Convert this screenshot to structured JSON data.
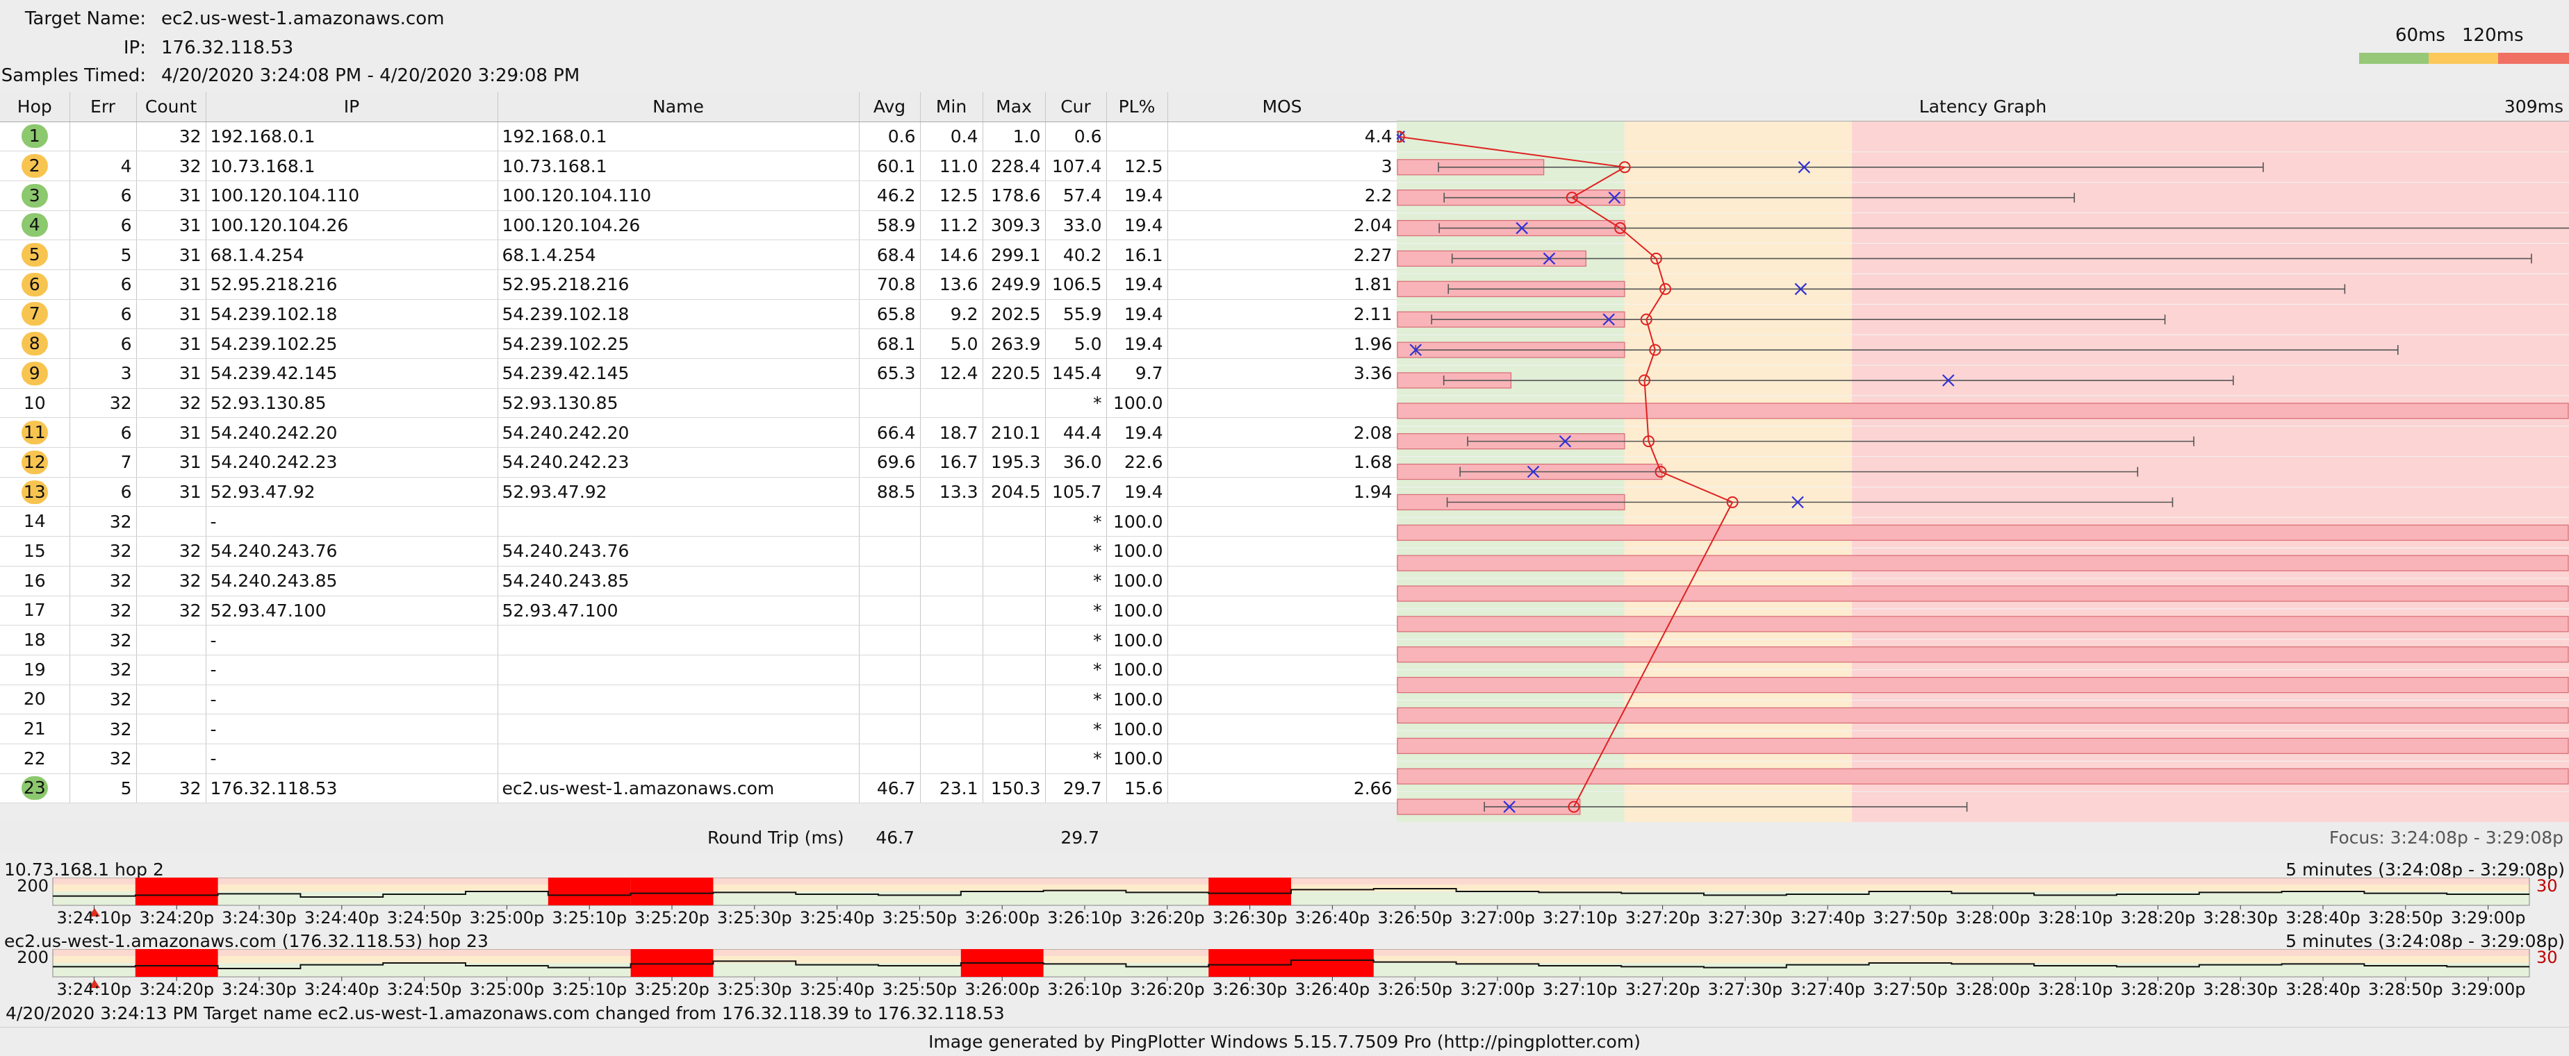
{
  "header": {
    "target_label": "Target Name:",
    "target_value": "ec2.us-west-1.amazonaws.com",
    "ip_label": "IP:",
    "ip_value": "176.32.118.53",
    "samples_label": "Samples Timed:",
    "samples_value": "4/20/2020 3:24:08 PM - 4/20/2020 3:29:08 PM"
  },
  "scale": {
    "label1": "60ms",
    "label2": "120ms",
    "color_good": "#96c878",
    "color_mid": "#fcc85a",
    "color_bad": "#f07064"
  },
  "columns": [
    "Hop",
    "Err",
    "Count",
    "IP",
    "Name",
    "Avg",
    "Min",
    "Max",
    "Cur",
    "PL%",
    "MOS"
  ],
  "graph_header": {
    "title": "Latency Graph",
    "max_label": "309ms"
  },
  "chart_data": {
    "type": "table",
    "title": "",
    "x_max_ms": 309,
    "zone_thresholds_ms": [
      60,
      120
    ],
    "rows": [
      {
        "hop": "1",
        "status": "green",
        "err": "",
        "count": "32",
        "ip": "192.168.0.1",
        "name": "192.168.0.1",
        "avg": "0.6",
        "min": "0.4",
        "max": "1.0",
        "cur": "0.6",
        "pl": "",
        "mos": "4.4"
      },
      {
        "hop": "2",
        "status": "orange",
        "err": "4",
        "count": "32",
        "ip": "10.73.168.1",
        "name": "10.73.168.1",
        "avg": "60.1",
        "min": "11.0",
        "max": "228.4",
        "cur": "107.4",
        "pl": "12.5",
        "mos": "3"
      },
      {
        "hop": "3",
        "status": "green",
        "err": "6",
        "count": "31",
        "ip": "100.120.104.110",
        "name": "100.120.104.110",
        "avg": "46.2",
        "min": "12.5",
        "max": "178.6",
        "cur": "57.4",
        "pl": "19.4",
        "mos": "2.2"
      },
      {
        "hop": "4",
        "status": "green",
        "err": "6",
        "count": "31",
        "ip": "100.120.104.26",
        "name": "100.120.104.26",
        "avg": "58.9",
        "min": "11.2",
        "max": "309.3",
        "cur": "33.0",
        "pl": "19.4",
        "mos": "2.04"
      },
      {
        "hop": "5",
        "status": "orange",
        "err": "5",
        "count": "31",
        "ip": "68.1.4.254",
        "name": "68.1.4.254",
        "avg": "68.4",
        "min": "14.6",
        "max": "299.1",
        "cur": "40.2",
        "pl": "16.1",
        "mos": "2.27"
      },
      {
        "hop": "6",
        "status": "orange",
        "err": "6",
        "count": "31",
        "ip": "52.95.218.216",
        "name": "52.95.218.216",
        "avg": "70.8",
        "min": "13.6",
        "max": "249.9",
        "cur": "106.5",
        "pl": "19.4",
        "mos": "1.81"
      },
      {
        "hop": "7",
        "status": "orange",
        "err": "6",
        "count": "31",
        "ip": "54.239.102.18",
        "name": "54.239.102.18",
        "avg": "65.8",
        "min": "9.2",
        "max": "202.5",
        "cur": "55.9",
        "pl": "19.4",
        "mos": "2.11"
      },
      {
        "hop": "8",
        "status": "orange",
        "err": "6",
        "count": "31",
        "ip": "54.239.102.25",
        "name": "54.239.102.25",
        "avg": "68.1",
        "min": "5.0",
        "max": "263.9",
        "cur": "5.0",
        "pl": "19.4",
        "mos": "1.96"
      },
      {
        "hop": "9",
        "status": "orange",
        "err": "3",
        "count": "31",
        "ip": "54.239.42.145",
        "name": "54.239.42.145",
        "avg": "65.3",
        "min": "12.4",
        "max": "220.5",
        "cur": "145.4",
        "pl": "9.7",
        "mos": "3.36"
      },
      {
        "hop": "10",
        "status": "none",
        "err": "32",
        "count": "32",
        "ip": "52.93.130.85",
        "name": "52.93.130.85",
        "avg": "",
        "min": "",
        "max": "",
        "cur": "*",
        "pl": "100.0",
        "mos": ""
      },
      {
        "hop": "11",
        "status": "orange",
        "err": "6",
        "count": "31",
        "ip": "54.240.242.20",
        "name": "54.240.242.20",
        "avg": "66.4",
        "min": "18.7",
        "max": "210.1",
        "cur": "44.4",
        "pl": "19.4",
        "mos": "2.08"
      },
      {
        "hop": "12",
        "status": "orange",
        "err": "7",
        "count": "31",
        "ip": "54.240.242.23",
        "name": "54.240.242.23",
        "avg": "69.6",
        "min": "16.7",
        "max": "195.3",
        "cur": "36.0",
        "pl": "22.6",
        "mos": "1.68"
      },
      {
        "hop": "13",
        "status": "orange",
        "err": "6",
        "count": "31",
        "ip": "52.93.47.92",
        "name": "52.93.47.92",
        "avg": "88.5",
        "min": "13.3",
        "max": "204.5",
        "cur": "105.7",
        "pl": "19.4",
        "mos": "1.94"
      },
      {
        "hop": "14",
        "status": "none",
        "err": "32",
        "count": "",
        "ip": "-",
        "name": "",
        "avg": "",
        "min": "",
        "max": "",
        "cur": "*",
        "pl": "100.0",
        "mos": ""
      },
      {
        "hop": "15",
        "status": "none",
        "err": "32",
        "count": "32",
        "ip": "54.240.243.76",
        "name": "54.240.243.76",
        "avg": "",
        "min": "",
        "max": "",
        "cur": "*",
        "pl": "100.0",
        "mos": ""
      },
      {
        "hop": "16",
        "status": "none",
        "err": "32",
        "count": "32",
        "ip": "54.240.243.85",
        "name": "54.240.243.85",
        "avg": "",
        "min": "",
        "max": "",
        "cur": "*",
        "pl": "100.0",
        "mos": ""
      },
      {
        "hop": "17",
        "status": "none",
        "err": "32",
        "count": "32",
        "ip": "52.93.47.100",
        "name": "52.93.47.100",
        "avg": "",
        "min": "",
        "max": "",
        "cur": "*",
        "pl": "100.0",
        "mos": ""
      },
      {
        "hop": "18",
        "status": "none",
        "err": "32",
        "count": "",
        "ip": "-",
        "name": "",
        "avg": "",
        "min": "",
        "max": "",
        "cur": "*",
        "pl": "100.0",
        "mos": ""
      },
      {
        "hop": "19",
        "status": "none",
        "err": "32",
        "count": "",
        "ip": "-",
        "name": "",
        "avg": "",
        "min": "",
        "max": "",
        "cur": "*",
        "pl": "100.0",
        "mos": ""
      },
      {
        "hop": "20",
        "status": "none",
        "err": "32",
        "count": "",
        "ip": "-",
        "name": "",
        "avg": "",
        "min": "",
        "max": "",
        "cur": "*",
        "pl": "100.0",
        "mos": ""
      },
      {
        "hop": "21",
        "status": "none",
        "err": "32",
        "count": "",
        "ip": "-",
        "name": "",
        "avg": "",
        "min": "",
        "max": "",
        "cur": "*",
        "pl": "100.0",
        "mos": ""
      },
      {
        "hop": "22",
        "status": "none",
        "err": "32",
        "count": "",
        "ip": "-",
        "name": "",
        "avg": "",
        "min": "",
        "max": "",
        "cur": "*",
        "pl": "100.0",
        "mos": ""
      },
      {
        "hop": "23",
        "status": "green",
        "err": "5",
        "count": "32",
        "ip": "176.32.118.53",
        "name": "ec2.us-west-1.amazonaws.com",
        "avg": "46.7",
        "min": "23.1",
        "max": "150.3",
        "cur": "29.7",
        "pl": "15.6",
        "mos": "2.66"
      }
    ]
  },
  "round_trip": {
    "label": "Round Trip (ms)",
    "avg": "46.7",
    "cur": "29.7",
    "focus": "Focus: 3:24:08p - 3:29:08p"
  },
  "timeline_ticks": [
    "3:24:10p",
    "3:24:20p",
    "3:24:30p",
    "3:24:40p",
    "3:24:50p",
    "3:25:00p",
    "3:25:10p",
    "3:25:20p",
    "3:25:30p",
    "3:25:40p",
    "3:25:50p",
    "3:26:00p",
    "3:26:10p",
    "3:26:20p",
    "3:26:30p",
    "3:26:40p",
    "3:26:50p",
    "3:27:00p",
    "3:27:10p",
    "3:27:20p",
    "3:27:30p",
    "3:27:40p",
    "3:27:50p",
    "3:28:00p",
    "3:28:10p",
    "3:28:20p",
    "3:28:30p",
    "3:28:40p",
    "3:28:50p",
    "3:29:00p"
  ],
  "strips": [
    {
      "title": "10.73.168.1 hop 2",
      "range": "5 minutes (3:24:08p - 3:29:08p)",
      "ylabel": "200",
      "pl_label": "30",
      "loss_segments": [
        [
          1,
          2
        ],
        [
          6,
          7
        ],
        [
          7,
          8
        ],
        [
          14,
          15
        ]
      ],
      "latency": [
        20,
        22,
        25,
        18,
        24,
        30,
        22,
        26,
        28,
        24,
        22,
        30,
        32,
        28,
        26,
        34,
        36,
        30,
        28,
        26,
        22,
        24,
        30,
        26,
        22,
        24,
        28,
        30,
        26,
        24
      ]
    },
    {
      "title": "ec2.us-west-1.amazonaws.com (176.32.118.53) hop 23",
      "range": "5 minutes (3:24:08p - 3:29:08p)",
      "ylabel": "200",
      "pl_label": "30",
      "loss_segments": [
        [
          1,
          2
        ],
        [
          7,
          8
        ],
        [
          11,
          12
        ],
        [
          14,
          15
        ],
        [
          15,
          16
        ]
      ],
      "latency": [
        22,
        24,
        18,
        26,
        30,
        24,
        20,
        28,
        34,
        26,
        24,
        30,
        28,
        22,
        26,
        36,
        32,
        28,
        24,
        22,
        20,
        26,
        30,
        28,
        24,
        22,
        26,
        28,
        24,
        22
      ]
    }
  ],
  "status_text": "4/20/2020 3:24:13 PM Target name ec2.us-west-1.amazonaws.com changed from 176.32.118.39 to 176.32.118.53",
  "footer_text": "Image generated by PingPlotter Windows 5.15.7.7509 Pro (http://pingplotter.com)"
}
